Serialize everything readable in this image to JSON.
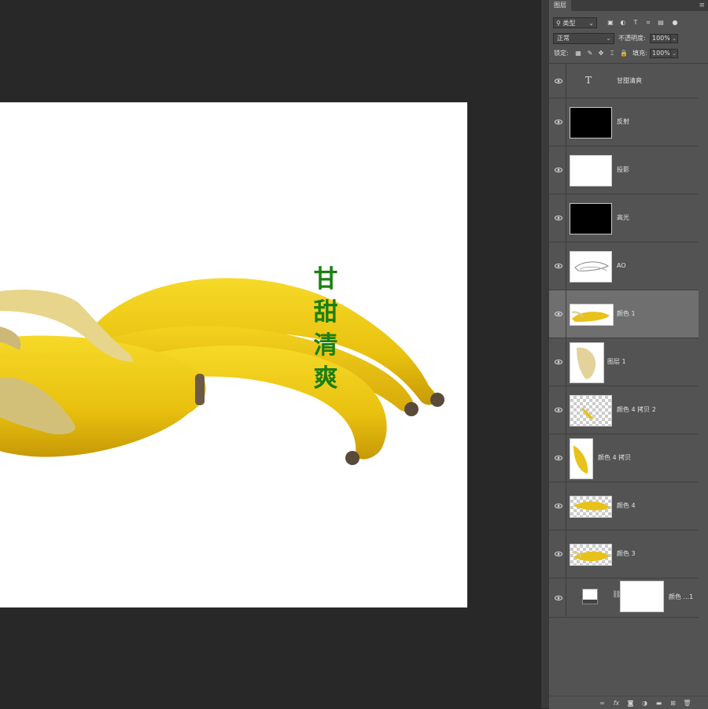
{
  "canvas": {
    "vertical_text": [
      "甘",
      "甜",
      "清",
      "爽"
    ],
    "text_color": "#1a7f14",
    "image": "bananas"
  },
  "panel": {
    "tab_label": "图层",
    "menu_icon": "panel-menu-icon",
    "filter": {
      "label": "类型",
      "icon": "search-icon"
    },
    "blend_mode": "正常",
    "opacity_label": "不透明度:",
    "opacity_value": "100%",
    "lock_label": "锁定:",
    "fill_label": "填充:",
    "fill_value": "100%",
    "layers": [
      {
        "name": "甘甜清爽",
        "thumb": "text",
        "selected": false
      },
      {
        "name": "反射",
        "thumb": "black",
        "selected": false
      },
      {
        "name": "投影",
        "thumb": "white",
        "selected": false
      },
      {
        "name": "高光",
        "thumb": "black",
        "selected": false
      },
      {
        "name": "AO",
        "thumb": "ao",
        "selected": false
      },
      {
        "name": "颜色 1",
        "thumb": "banana",
        "selected": true
      },
      {
        "name": "图层 1",
        "thumb": "peel",
        "selected": false
      },
      {
        "name": "颜色 4 拷贝 2",
        "thumb": "checker",
        "selected": false
      },
      {
        "name": "颜色 4 拷贝",
        "thumb": "slice",
        "selected": false
      },
      {
        "name": "颜色 4",
        "thumb": "checker-banana",
        "selected": false
      },
      {
        "name": "颜色 3",
        "thumb": "banana",
        "selected": false
      },
      {
        "name": "颜色 ...1",
        "thumb": "adjustment",
        "selected": false
      }
    ],
    "bottom_icons": [
      "link-icon",
      "fx-icon",
      "mask-icon",
      "adjustment-icon",
      "folder-icon",
      "new-layer-icon",
      "trash-icon"
    ]
  }
}
